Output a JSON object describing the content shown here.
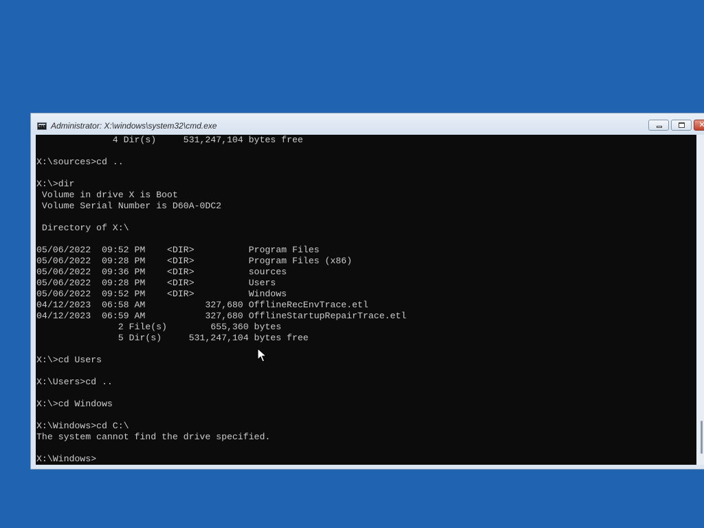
{
  "window": {
    "title": "Administrator: X:\\windows\\system32\\cmd.exe",
    "icon": "cmd-icon",
    "buttons": {
      "minimize": "minimize-icon",
      "maximize": "maximize-icon",
      "close": "close-icon",
      "close_glyph": "✕"
    }
  },
  "console": {
    "lines": [
      "              4 Dir(s)     531,247,104 bytes free",
      "",
      "X:\\sources>cd ..",
      "",
      "X:\\>dir",
      " Volume in drive X is Boot",
      " Volume Serial Number is D60A-0DC2",
      "",
      " Directory of X:\\",
      "",
      "05/06/2022  09:52 PM    <DIR>          Program Files",
      "05/06/2022  09:28 PM    <DIR>          Program Files (x86)",
      "05/06/2022  09:36 PM    <DIR>          sources",
      "05/06/2022  09:28 PM    <DIR>          Users",
      "05/06/2022  09:52 PM    <DIR>          Windows",
      "04/12/2023  06:58 AM           327,680 OfflineRecEnvTrace.etl",
      "04/12/2023  06:59 AM           327,680 OfflineStartupRepairTrace.etl",
      "               2 File(s)        655,360 bytes",
      "               5 Dir(s)     531,247,104 bytes free",
      "",
      "X:\\>cd Users",
      "",
      "X:\\Users>cd ..",
      "",
      "X:\\>cd Windows",
      "",
      "X:\\Windows>cd C:\\",
      "The system cannot find the drive specified.",
      "",
      "X:\\Windows>"
    ]
  },
  "colors": {
    "desktop": "#2063b0",
    "console_bg": "#0c0c0c",
    "console_fg": "#cccccc"
  }
}
